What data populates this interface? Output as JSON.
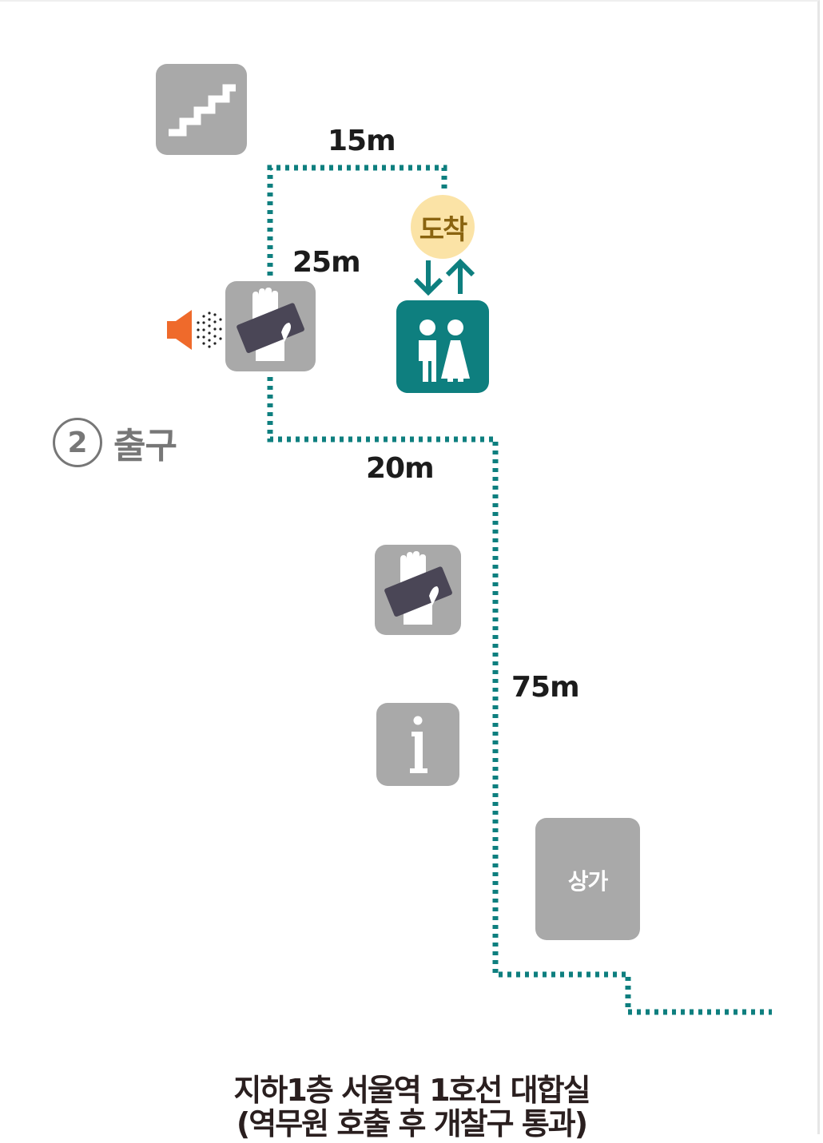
{
  "distances": {
    "top": "15m",
    "upper": "25m",
    "middle": "20m",
    "long": "75m"
  },
  "arrival_label": "도착",
  "exit": {
    "number": "2",
    "label": "출구"
  },
  "shop_label": "상가",
  "caption": {
    "line1": "지하1층 서울역 1호선 대합실",
    "line2": "(역무원 호출 후 개찰구 통과)"
  },
  "colors": {
    "path": "#0e7f7f",
    "tile": "#a9a9a9",
    "elevator": "#0e7f7f",
    "arrival_bg": "#fbe3a6",
    "speaker": "#ef6a2b"
  },
  "icons": [
    "stairs-icon",
    "gate-card-icon",
    "speaker-icon",
    "elevator-icon",
    "info-icon",
    "elevator-arrows-icon"
  ]
}
